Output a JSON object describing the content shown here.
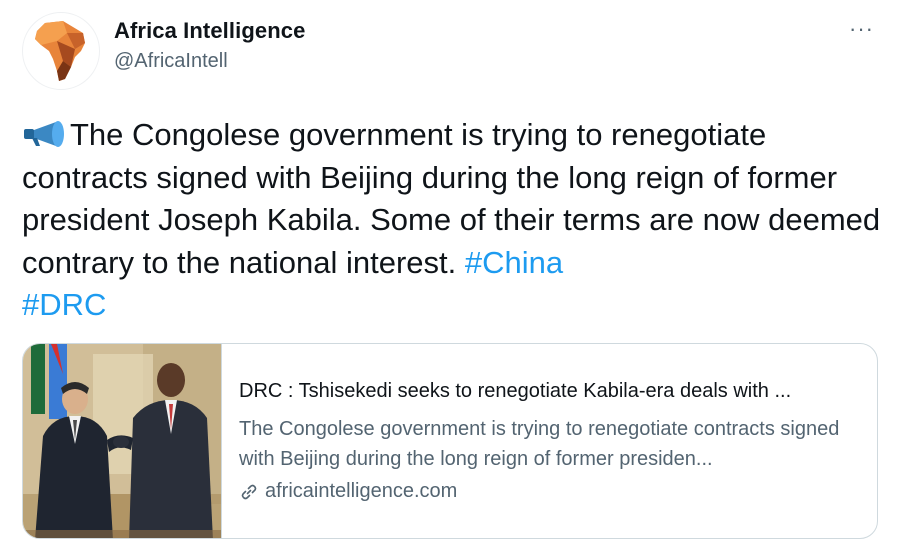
{
  "account": {
    "name": "Africa Intelligence",
    "handle": "@AfricaIntell"
  },
  "menu": {
    "more_label": "···"
  },
  "tweet": {
    "emoji_icon": "megaphone-icon",
    "text_main": "The Congolese government is trying to renegotiate contracts signed with Beijing during the long reign of former president Joseph Kabila. Some of their terms are now deemed contrary to the national interest.",
    "hashtag_1": "#China",
    "hashtag_2": "#DRC"
  },
  "card": {
    "title": "DRC : Tshisekedi seeks to renegotiate Kabila-era deals with ...",
    "description": "The Congolese government is trying to renegotiate contracts signed with Beijing during the long reign of former presiden...",
    "domain": "africaintelligence.com",
    "link_icon": "link-icon"
  },
  "colors": {
    "text": "#0f1419",
    "secondary": "#536471",
    "hashtag": "#1d9bf0",
    "border": "#cfd9de",
    "logo_orange": "#e8843a"
  }
}
